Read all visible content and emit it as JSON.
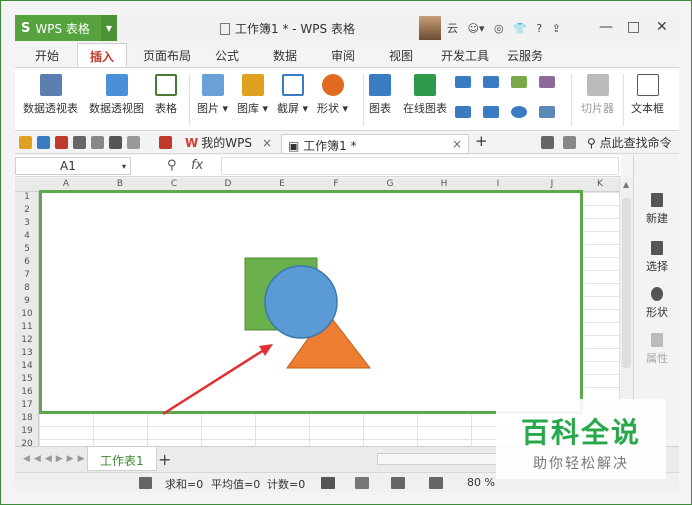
{
  "window": {
    "app_name": "WPS 表格",
    "app_logo": "S",
    "doc_title": "工作簿1 * - WPS 表格",
    "user_label": "云",
    "top_icons": [
      "◎",
      "👕",
      "?"
    ],
    "win_controls": [
      "—",
      "□",
      "✕"
    ]
  },
  "ribbon_tabs": [
    "开始",
    "插入",
    "页面布局",
    "公式",
    "数据",
    "审阅",
    "视图",
    "开发工具",
    "云服务"
  ],
  "ribbon": {
    "buttons": [
      {
        "label": "数据透视表",
        "icon": "pivot-table-icon",
        "color": "#5b7fb0"
      },
      {
        "label": "数据透视图",
        "icon": "pivot-chart-icon",
        "color": "#4a90d9"
      },
      {
        "label": "表格",
        "icon": "table-icon",
        "color": "#4a7a3a"
      },
      {
        "label": "图片",
        "icon": "picture-icon",
        "color": "#6aa0d8"
      },
      {
        "label": "图库",
        "icon": "gallery-icon",
        "color": "#e0a020"
      },
      {
        "label": "截屏",
        "icon": "screenshot-icon",
        "color": "#3a7cc2"
      },
      {
        "label": "形状",
        "icon": "shape-icon",
        "color": "#e06a20"
      },
      {
        "label": "图表",
        "icon": "chart-icon",
        "color": "#3a7cc2"
      },
      {
        "label": "在线图表",
        "icon": "online-chart-icon",
        "color": "#2f9a4a"
      },
      {
        "label": "切片器",
        "icon": "slicer-icon",
        "color": "#aaaaaa"
      },
      {
        "label": "文本框",
        "icon": "textbox-icon",
        "color": "#555555"
      }
    ]
  },
  "doc_tabs": {
    "my_wps": "我的WPS",
    "current": "工作簿1 *",
    "search": "点此查找命令"
  },
  "formula_bar": {
    "name_box": "A1",
    "fx": "fx"
  },
  "sheet": {
    "columns": [
      "A",
      "B",
      "C",
      "D",
      "E",
      "F",
      "G",
      "H",
      "I",
      "J",
      "K"
    ],
    "rows": [
      "1",
      "2",
      "3",
      "4",
      "5",
      "6",
      "7",
      "8",
      "9",
      "10",
      "11",
      "12",
      "13",
      "14",
      "15",
      "16",
      "17",
      "18",
      "19",
      "20"
    ]
  },
  "side_panel": [
    "新建",
    "选择",
    "形状",
    "属性"
  ],
  "sheet_tabs": {
    "active": "工作表1",
    "add": "+"
  },
  "status": {
    "sum": "求和=0",
    "avg": "平均值=0",
    "count": "计数=0",
    "zoom": "80 %"
  },
  "watermark": {
    "title": "百科全说",
    "subtitle": "助你轻松解决"
  },
  "colors": {
    "brand_green": "#56a23f",
    "shape_green": "#6ab04c",
    "shape_blue": "#5b9bd5",
    "shape_orange": "#ed7d31",
    "arrow_red": "#e03030",
    "highlight_green": "#5ba94a"
  }
}
